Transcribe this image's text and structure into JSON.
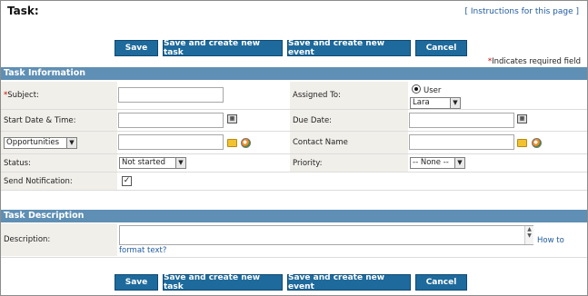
{
  "page": {
    "title": "Task:",
    "instructions_link": "[ Instructions for this page ]"
  },
  "buttons": {
    "save": "Save",
    "save_new_task": "Save and create new task",
    "save_new_event": "Save and create new event",
    "cancel": "Cancel"
  },
  "required_note": {
    "star": "*",
    "text": "Indicates required field"
  },
  "task_info": {
    "header": "Task Information",
    "subject_label": "Subject:",
    "subject_required": "*",
    "subject_value": "",
    "assigned_to_label": "Assigned To:",
    "assigned_type": "User",
    "assigned_user": "Lara",
    "start_label": "Start Date & Time:",
    "start_value": "",
    "due_label": "Due Date:",
    "due_value": "",
    "related_select": "Opportunities",
    "related_value": "",
    "contact_label": "Contact Name",
    "contact_value": "",
    "status_label": "Status:",
    "status_value": "Not started",
    "priority_label": "Priority:",
    "priority_value": "-- None --",
    "notify_label": "Send Notification:",
    "notify_checked": "✓"
  },
  "task_description": {
    "header": "Task Description",
    "description_label": "Description:",
    "description_value": "",
    "format_link_1": "How to",
    "format_link_2": "format text?"
  },
  "icons": {
    "calendar": "calendar-icon",
    "folder": "folder-icon",
    "clear": "clear-icon",
    "dropdown": "chevron-down-icon"
  },
  "colors": {
    "button_bg": "#1e6a9c",
    "section_bg": "#5f8fb4",
    "label_bg": "#f1efea",
    "link": "#1f5a9e",
    "required": "#cc0000"
  }
}
